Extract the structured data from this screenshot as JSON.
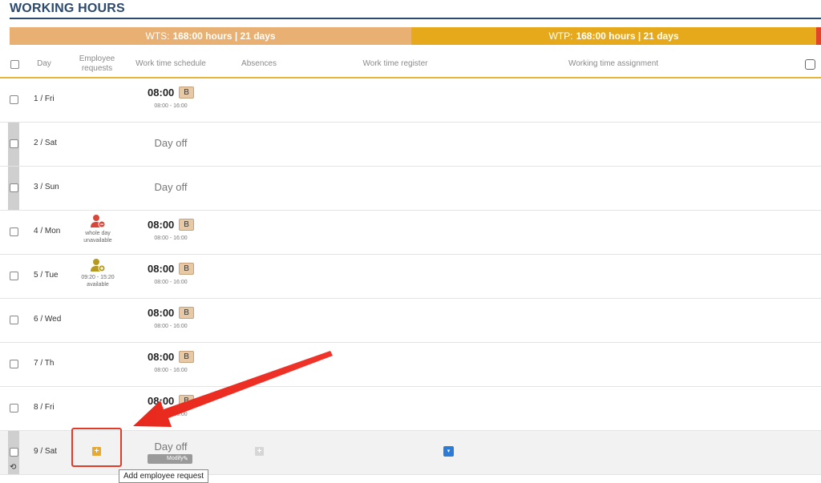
{
  "page": {
    "title": "WORKING HOURS"
  },
  "summary": {
    "wts_label": "WTS:",
    "wts_value": "168:00 hours | 21 days",
    "wtp_label": "WTP:",
    "wtp_value": "168:00 hours | 21 days"
  },
  "headers": {
    "day": "Day",
    "employee_requests": "Employee requests",
    "work_time_schedule": "Work time schedule",
    "absences": "Absences",
    "work_time_register": "Work time register",
    "working_time_assignment": "Working time assignment"
  },
  "rows": [
    {
      "day": "1 / Fri",
      "time": "08:00",
      "badge": "B",
      "range": "08:00 - 16:00"
    },
    {
      "day": "2 / Sat",
      "dayoff": "Day off"
    },
    {
      "day": "3 / Sun",
      "dayoff": "Day off"
    },
    {
      "day": "4 / Mon",
      "time": "08:00",
      "badge": "B",
      "range": "08:00 - 16:00",
      "request_line1": "whole day",
      "request_line2": "unavailable"
    },
    {
      "day": "5 / Tue",
      "time": "08:00",
      "badge": "B",
      "range": "08:00 - 16:00",
      "request_line1": "09:20 - 15:20",
      "request_line2": "available"
    },
    {
      "day": "6 / Wed",
      "time": "08:00",
      "badge": "B",
      "range": "08:00 - 16:00"
    },
    {
      "day": "7 / Th",
      "time": "08:00",
      "badge": "B",
      "range": "08:00 - 16:00"
    },
    {
      "day": "8 / Fri",
      "time": "08:00",
      "badge": "B",
      "range": "08:00 - 16:00"
    },
    {
      "day": "9 / Sat",
      "dayoff": "Day off",
      "modify_label": "Modify"
    }
  ],
  "tooltip": {
    "text": "Add employee request"
  },
  "icons": {
    "plus": "+",
    "dropdown": "▾",
    "pencil": "✎",
    "history": "⟲"
  },
  "colors": {
    "wts": "#e8b072",
    "wtp": "#e6a91c",
    "unavailable": "#d9473a",
    "available": "#b59a1f",
    "highlight": "#e23a2b"
  }
}
